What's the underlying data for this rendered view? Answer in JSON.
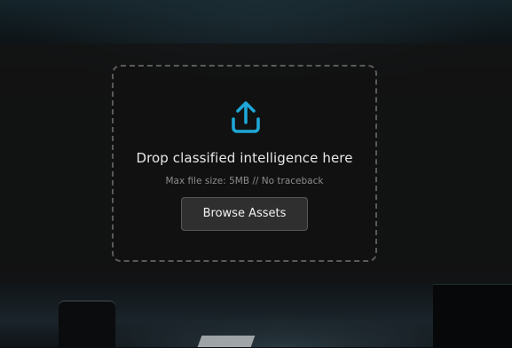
{
  "dropzone": {
    "icon": "upload-icon",
    "title": "Drop classified intelligence here",
    "subtitle": "Max file size: 5MB // No traceback",
    "browse_label": "Browse Assets"
  },
  "colors": {
    "accent": "#1ea7d6",
    "overlay": "#141414",
    "button_bg": "#2f2f2f"
  }
}
